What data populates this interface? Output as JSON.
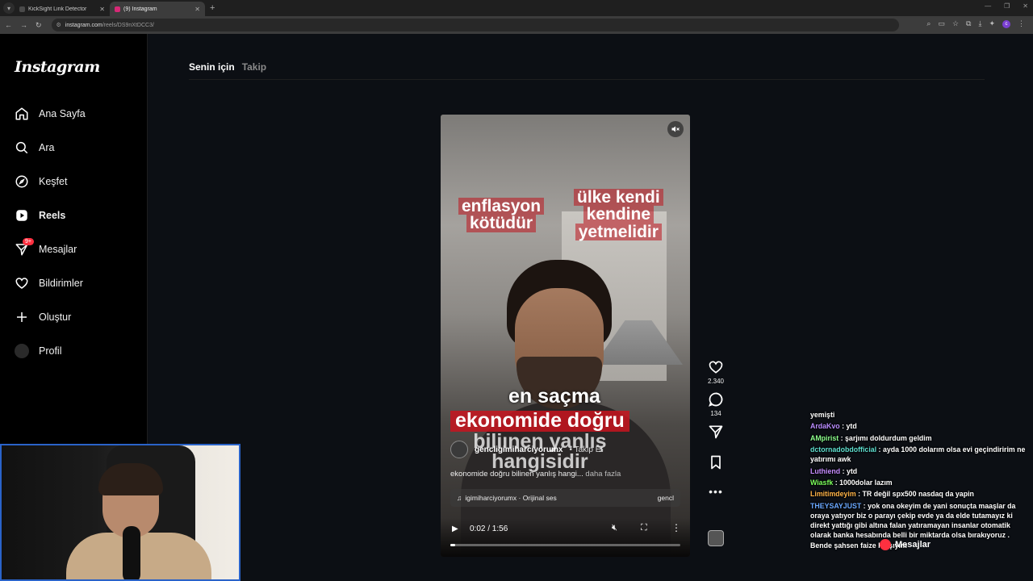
{
  "browser": {
    "tabs": [
      {
        "label": "KickSight Link Detector",
        "favicon_color": "#4a4a4a"
      },
      {
        "label": "(9) Instagram",
        "favicon_color": "#d62976"
      }
    ],
    "url_host": "instagram.com",
    "url_path": "/reels/DS9nXtDCC3/"
  },
  "sidebar": {
    "logo": "Instagram",
    "items": [
      {
        "label": "Ana Sayfa",
        "icon": "home-icon"
      },
      {
        "label": "Ara",
        "icon": "search-icon"
      },
      {
        "label": "Keşfet",
        "icon": "compass-icon"
      },
      {
        "label": "Reels",
        "icon": "reels-icon"
      },
      {
        "label": "Mesajlar",
        "icon": "messages-icon",
        "badge": "9+"
      },
      {
        "label": "Bildirimler",
        "icon": "heart-icon"
      },
      {
        "label": "Oluştur",
        "icon": "plus-icon"
      },
      {
        "label": "Profil",
        "icon": "profile-avatar"
      }
    ]
  },
  "feed": {
    "tab_for_you": "Senin için",
    "tab_following": "Takip"
  },
  "reel": {
    "caption_left": [
      "enflasyon",
      "kötüdür"
    ],
    "caption_right": [
      "ülke kendi",
      "kendine",
      "yetmelidir"
    ],
    "caption_mid": "en saçma",
    "caption_red": "ekonomide doğru",
    "caption_ghost1": "biliınen yanlış",
    "caption_ghost2": "hangisidir",
    "author": "gencligimiharciyorumx",
    "follow": "Takip Et",
    "description": "ekonomide doğru bilinen yanlış hangi...",
    "more": "daha fazla",
    "audio": "igimiharciyorumx · Orijinal ses",
    "audio_right": "gencl",
    "time": "0:02 / 1:56",
    "progress": 0.02
  },
  "actions": {
    "likes": "2.340",
    "comments": "134"
  },
  "chat": [
    {
      "user": "",
      "msg": "yemişti",
      "color": "#ffffff"
    },
    {
      "user": "ArdaKvo",
      "msg": "ytd",
      "color": "#b98cff"
    },
    {
      "user": "AMpirist",
      "msg": "şarjımı doldurdum geldim",
      "color": "#8cff8c"
    },
    {
      "user": "dctornadobdofficial",
      "msg": "ayda 1000 dolarım olsa evi geçindiririm ne yatırımı awk",
      "color": "#5fe0d0"
    },
    {
      "user": "Luthiend",
      "msg": "ytd",
      "color": "#c58cff"
    },
    {
      "user": "Wiasfk",
      "msg": "1000dolar lazım",
      "color": "#7cff5c"
    },
    {
      "user": "Limitimdeyim",
      "msg": "TR değil spx500 nasdaq da yapin",
      "color": "#ffb347"
    },
    {
      "user": "THEYSAYJUST",
      "msg": "yok ona okeyim de yani sonuçta maaşlar da oraya yatıyor biz o parayı çekip evde ya da elde tutamayız ki direkt yattığı gibi altına falan yatıramayan insanlar otomatik olarak banka hesabında belli bir miktarda olsa bırakıyoruz . Bende şahsen faize karşıyım",
      "color": "#6aa8ff"
    }
  ],
  "floating_messages": "Mesajlar"
}
